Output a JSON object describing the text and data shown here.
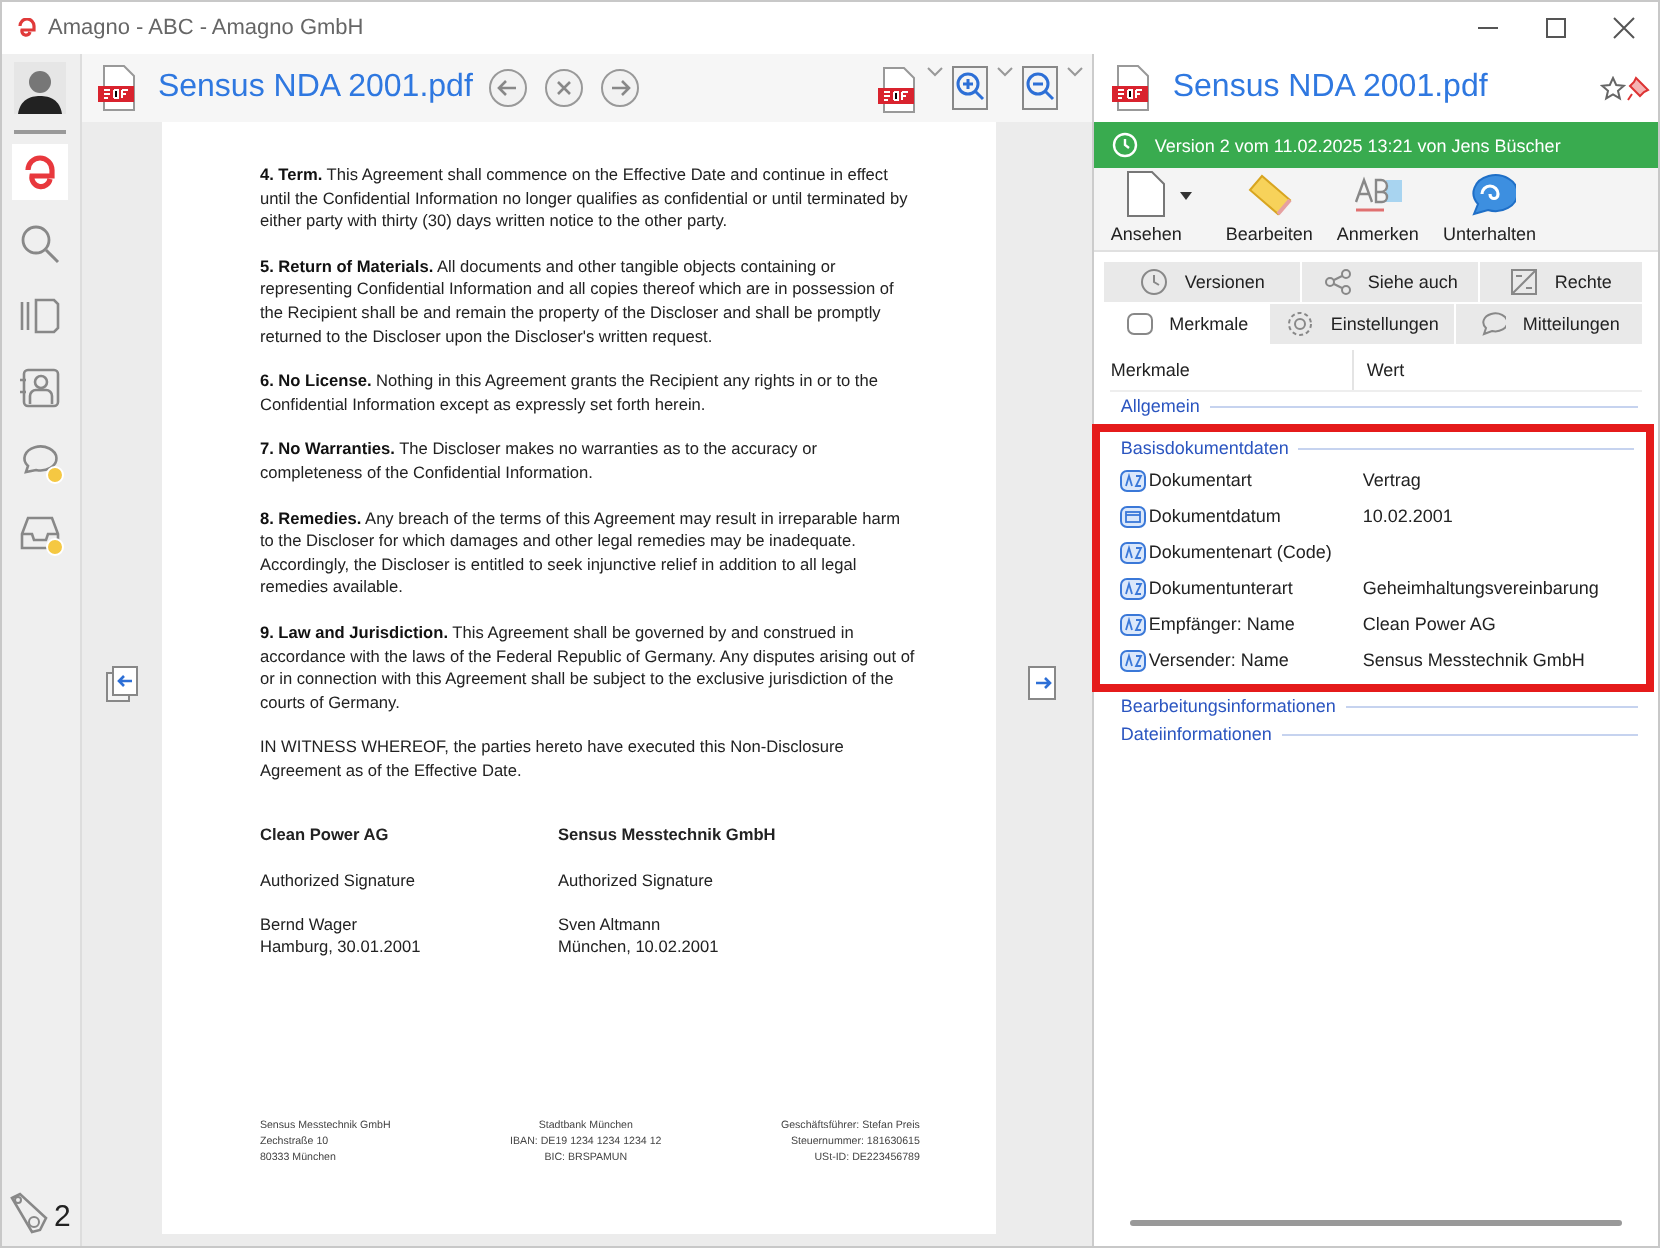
{
  "window": {
    "title": "Amagno - ABC - Amagno GmbH"
  },
  "sidebar": {
    "items": [
      {
        "kind": "logo",
        "selected": true,
        "badge": false
      },
      {
        "kind": "search",
        "selected": false,
        "badge": false
      },
      {
        "kind": "cards",
        "selected": false,
        "badge": false
      },
      {
        "kind": "contacts",
        "selected": false,
        "badge": false
      },
      {
        "kind": "chat",
        "selected": false,
        "badge": true
      },
      {
        "kind": "inbox",
        "selected": false,
        "badge": true
      }
    ],
    "counter": "2"
  },
  "viewer": {
    "title": "Sensus NDA 2001.pdf",
    "paragraphs": [
      "**4. Term.** This Agreement shall commence on the Effective Date and continue in effect until the Confidential Information no longer qualifies as confidential or until terminated by either party with thirty (30) days written notice to the other party.",
      "**5. Return of Materials.** All documents and other tangible objects containing or representing Confidential Information and all copies thereof which are in possession of the Recipient shall be and remain the property of the Discloser and shall be promptly returned to the Discloser upon the Discloser's written request.",
      "**6. No License.** Nothing in this Agreement grants the Recipient any rights in or to the Confidential Information except as expressly set forth herein.",
      "**7. No Warranties.** The Discloser makes no warranties as to the accuracy or completeness of the Confidential Information.",
      "**8. Remedies.** Any breach of the terms of this Agreement may result in irreparable harm to the Discloser for which damages and other legal remedies may be inadequate. Accordingly, the Discloser is entitled to seek injunctive relief in addition to all legal remedies available.",
      "**9. Law and Jurisdiction.** This Agreement shall be governed by and construed in accordance with the laws of the Federal Republic of Germany. Any disputes arising out of or in connection with this Agreement shall be subject to the exclusive jurisdiction of the courts of Germany.",
      "IN WITNESS WHEREOF, the parties hereto have executed this Non-Disclosure Agreement as of the Effective Date."
    ],
    "signatures": [
      {
        "company": "Clean Power AG",
        "role": "Authorized Signature",
        "name": "Bernd Wager",
        "place_date": "Hamburg, 30.01.2001"
      },
      {
        "company": "Sensus Messtechnik GmbH",
        "role": "Authorized Signature",
        "name": "Sven Altmann",
        "place_date": "München, 10.02.2001"
      }
    ],
    "footer": [
      [
        "Sensus Messtechnik GmbH",
        "Zechstraße 10",
        "80333 München"
      ],
      [
        "Stadtbank München",
        "IBAN: DE19 1234 1234 1234 12",
        "BIC: BRSPAMUN"
      ],
      [
        "Geschäftsführer: Stefan Preis",
        "Steuernummer: 181630615",
        "USt-ID: DE223456789"
      ]
    ]
  },
  "panel": {
    "title": "Sensus NDA 2001.pdf",
    "version": "Version 2 vom 11.02.2025 13:21 von Jens Büscher",
    "actions": [
      {
        "kind": "view",
        "label": "Ansehen",
        "has_menu": true
      },
      {
        "kind": "edit",
        "label": "Bearbeiten",
        "has_menu": false
      },
      {
        "kind": "annotate",
        "label": "Anmerken",
        "has_menu": false
      },
      {
        "kind": "chat",
        "label": "Unterhalten",
        "has_menu": false
      }
    ],
    "tab_rows": [
      [
        {
          "kind": "versions",
          "label": "Versionen",
          "selected": false
        },
        {
          "kind": "related",
          "label": "Siehe auch",
          "selected": false
        },
        {
          "kind": "rights",
          "label": "Rechte",
          "selected": false
        }
      ],
      [
        {
          "kind": "properties",
          "label": "Merkmale",
          "selected": true
        },
        {
          "kind": "settings",
          "label": "Einstellungen",
          "selected": false
        },
        {
          "kind": "messages",
          "label": "Mitteilungen",
          "selected": false
        }
      ]
    ],
    "columns": [
      "Merkmale",
      "Wert"
    ],
    "groups": [
      {
        "title": "Allgemein",
        "highlighted": false
      },
      {
        "title": "Basisdokumentdaten",
        "highlighted": true,
        "rows": [
          {
            "kind": "text",
            "label": "Dokumentart",
            "value": "Vertrag"
          },
          {
            "kind": "date",
            "label": "Dokumentdatum",
            "value": "10.02.2001"
          },
          {
            "kind": "text",
            "label": "Dokumentenart (Code)"
          },
          {
            "kind": "text",
            "label": "Dokumentunterart",
            "value": "Geheimhaltungsvereinbarung"
          },
          {
            "kind": "text",
            "label": "Empfänger: Name",
            "value": "Clean Power AG"
          },
          {
            "kind": "text",
            "label": "Versender: Name",
            "value": "Sensus Messtechnik GmbH"
          }
        ]
      },
      {
        "title": "Bearbeitungsinformationen",
        "highlighted": false
      },
      {
        "title": "Dateiinformationen",
        "highlighted": false
      }
    ]
  }
}
